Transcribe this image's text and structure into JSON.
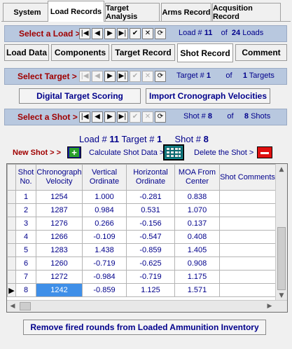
{
  "main_tabs": [
    "System",
    "Load Records",
    "Target Analysis",
    "Arms Record",
    "Acqusition Record"
  ],
  "load_nav": {
    "label": "Select a Load >",
    "num_label": "Load #",
    "num": "11",
    "of": "of",
    "total": "24",
    "total_label": "Loads"
  },
  "sub_tabs": [
    "Load Data",
    "Components",
    "Target Record",
    "Shot Record",
    "Comment"
  ],
  "target_nav": {
    "label": "Select Target >",
    "num_label": "Target #",
    "num": "1",
    "of": "of",
    "total": "1",
    "total_label": "Targets"
  },
  "buttons": {
    "digital": "Digital Target Scoring",
    "import": "Import Cronograph Velocities",
    "remove": "Remove fired rounds from Loaded Ammunition  Inventory"
  },
  "shot_nav": {
    "label": "Select a Shot >",
    "num_label": "Shot #",
    "num": "8",
    "of": "of",
    "total": "8",
    "total_label": "Shots"
  },
  "summary": {
    "load_label": "Load #",
    "load": "11",
    "target_label": "Target #",
    "target": "1",
    "shot_label": "Shot #",
    "shot": "8"
  },
  "actions": {
    "new_shot": "New Shot > >",
    "calculate": "Calculate Shot Data >",
    "delete": "Delete  the Shot >"
  },
  "table": {
    "headers": [
      "Shot No.",
      "Chronograph Velocity",
      "Vertical Ordinate",
      "Horizontal Ordinate",
      "MOA From Center",
      "Shot Comments"
    ],
    "rows": [
      [
        "1",
        "1254",
        "1.000",
        "-0.281",
        "0.838",
        ""
      ],
      [
        "2",
        "1287",
        "0.984",
        "0.531",
        "1.070",
        ""
      ],
      [
        "3",
        "1276",
        "0.266",
        "-0.156",
        "0.137",
        ""
      ],
      [
        "4",
        "1266",
        "-0.109",
        "-0.547",
        "0.408",
        ""
      ],
      [
        "5",
        "1283",
        "1.438",
        "-0.859",
        "1.405",
        ""
      ],
      [
        "6",
        "1260",
        "-0.719",
        "-0.625",
        "0.908",
        ""
      ],
      [
        "7",
        "1272",
        "-0.984",
        "-0.719",
        "1.175",
        ""
      ],
      [
        "8",
        "1242",
        "-0.859",
        "1.125",
        "1.571",
        ""
      ]
    ]
  },
  "colors": {
    "nav_bg": "#b8c8df",
    "label_red": "#a00000",
    "text_blue": "#00008b",
    "highlight": "#3f8fe8"
  }
}
